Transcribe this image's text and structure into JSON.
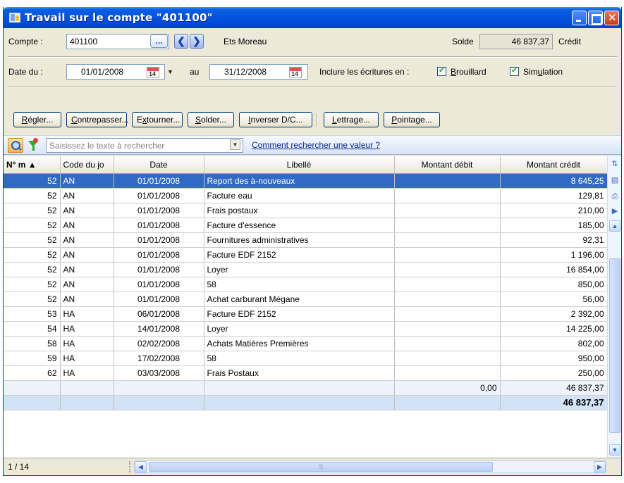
{
  "window": {
    "title": "Travail sur le compte \"401100\""
  },
  "account": {
    "label": "Compte :",
    "value": "401100",
    "browse": "...",
    "prev": "❮",
    "next": "❯",
    "name": "Ets Moreau",
    "balance_label": "Solde",
    "balance": "46 837,37",
    "balance_type": "Crédit"
  },
  "dates": {
    "from_label": "Date du :",
    "from": "01/01/2008",
    "to_label": "au",
    "to": "31/12/2008",
    "calendar_day": "14",
    "include_label": "Inclure les écritures en :",
    "brouillard": {
      "label_ul": "B",
      "label_rest": "rouillard",
      "checked": true
    },
    "simulation": {
      "label_pre": "Sim",
      "label_ul": "u",
      "label_rest": "lation",
      "checked": true
    }
  },
  "toolbar": {
    "regler": {
      "ul": "R",
      "rest": "égler..."
    },
    "contrepasser": {
      "ul": "C",
      "rest": "ontrepasser..."
    },
    "extourner": {
      "pre": "E",
      "ul": "x",
      "rest": "tourner..."
    },
    "solder": {
      "ul": "S",
      "rest": "older..."
    },
    "inverser": {
      "ul": "I",
      "rest": "nverser D/C..."
    },
    "lettrage": {
      "ul": "L",
      "rest": "ettrage..."
    },
    "pointage": {
      "ul": "P",
      "rest": "ointage..."
    }
  },
  "search": {
    "placeholder": "Saisissez le texte à rechercher",
    "help_link": "Comment rechercher une valeur ?"
  },
  "table": {
    "columns": [
      "N° m ▲",
      "Code du jo",
      "Date",
      "Libellé",
      "Montant débit",
      "Montant crédit"
    ],
    "rows": [
      [
        "52",
        "AN",
        "01/01/2008",
        "Report des à-nouveaux",
        "",
        "8 645,25"
      ],
      [
        "52",
        "AN",
        "01/01/2008",
        "Facture eau",
        "",
        "129,81"
      ],
      [
        "52",
        "AN",
        "01/01/2008",
        "Frais postaux",
        "",
        "210,00"
      ],
      [
        "52",
        "AN",
        "01/01/2008",
        "Facture d'essence",
        "",
        "185,00"
      ],
      [
        "52",
        "AN",
        "01/01/2008",
        "Fournitures administratives",
        "",
        "92,31"
      ],
      [
        "52",
        "AN",
        "01/01/2008",
        "Facture EDF 2152",
        "",
        "1 196,00"
      ],
      [
        "52",
        "AN",
        "01/01/2008",
        "Loyer",
        "",
        "16 854,00"
      ],
      [
        "52",
        "AN",
        "01/01/2008",
        "58",
        "",
        "850,00"
      ],
      [
        "52",
        "AN",
        "01/01/2008",
        "Achat carburant Mégane",
        "",
        "56,00"
      ],
      [
        "53",
        "HA",
        "06/01/2008",
        "Facture EDF 2152",
        "",
        "2 392,00"
      ],
      [
        "54",
        "HA",
        "14/01/2008",
        "Loyer",
        "",
        "14 225,00"
      ],
      [
        "58",
        "HA",
        "02/02/2008",
        "Achats Matières Premières",
        "",
        "802,00"
      ],
      [
        "59",
        "HA",
        "17/02/2008",
        "58",
        "",
        "950,00"
      ],
      [
        "62",
        "HA",
        "03/03/2008",
        "Frais Postaux",
        "",
        "250,00"
      ]
    ],
    "totals": {
      "debit": "0,00",
      "credit": "46 837,37"
    },
    "balance_total": "46 837,37"
  },
  "status": {
    "position": "1 / 14"
  }
}
